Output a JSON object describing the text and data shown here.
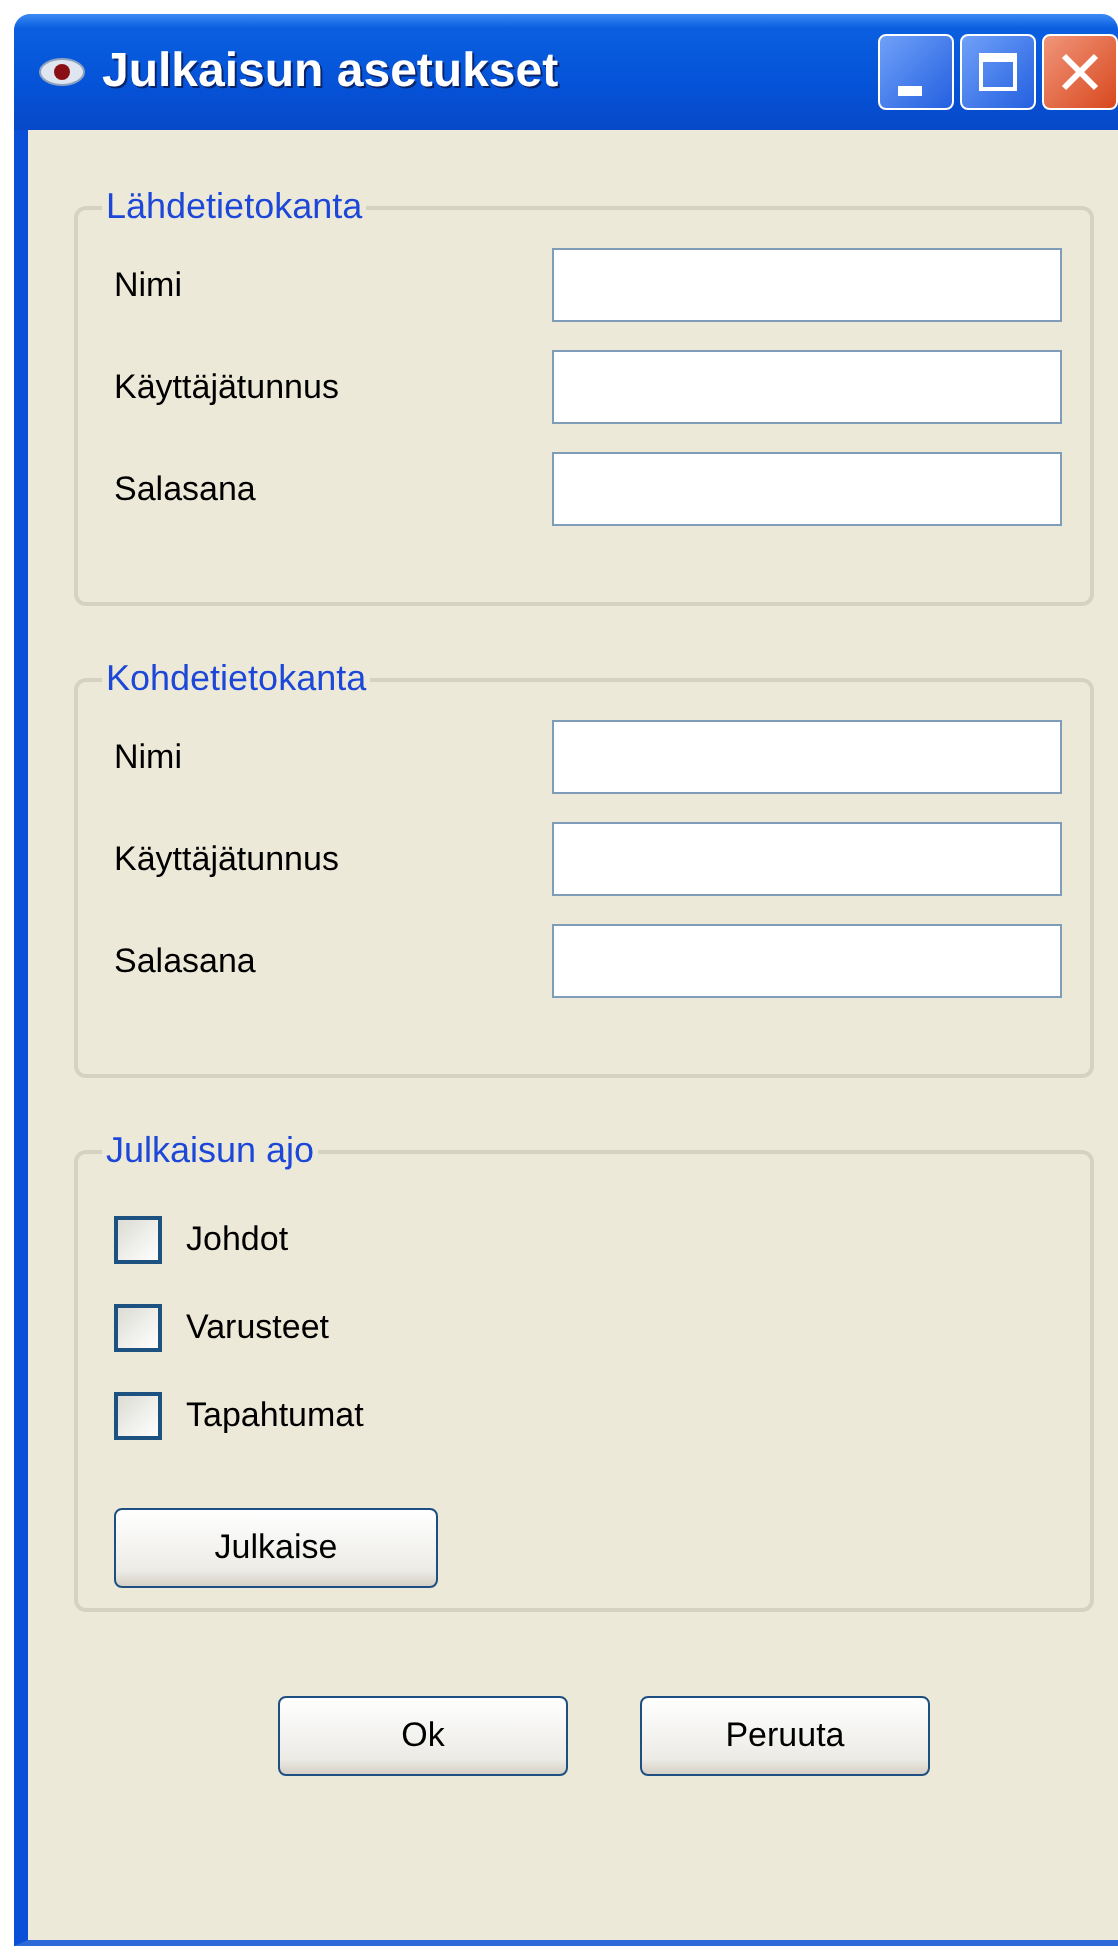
{
  "window": {
    "title": "Julkaisun asetukset"
  },
  "groups": [
    {
      "kind": "fields",
      "legend": "Lähdetietokanta",
      "fields": [
        {
          "label": "Nimi"
        },
        {
          "label": "Käyttäjätunnus"
        },
        {
          "label": "Salasana"
        }
      ]
    },
    {
      "kind": "fields",
      "legend": "Kohdetietokanta",
      "fields": [
        {
          "label": "Nimi"
        },
        {
          "label": "Käyttäjätunnus"
        },
        {
          "label": "Salasana"
        }
      ]
    },
    {
      "kind": "checks",
      "legend": "Julkaisun ajo",
      "checkboxes": [
        {
          "label": "Johdot",
          "checked": false
        },
        {
          "label": "Varusteet",
          "checked": false
        },
        {
          "label": "Tapahtumat",
          "checked": false
        }
      ],
      "button": "Julkaise"
    }
  ],
  "buttons": [
    "Ok",
    "Peruuta"
  ]
}
